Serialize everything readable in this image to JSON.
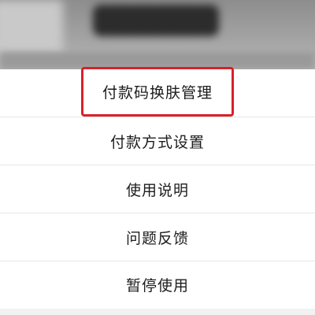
{
  "menu": {
    "items": [
      {
        "label": "付款码换肤管理",
        "highlighted": true
      },
      {
        "label": "付款方式设置"
      },
      {
        "label": "使用说明"
      },
      {
        "label": "问题反馈"
      },
      {
        "label": "暂停使用"
      }
    ]
  },
  "colors": {
    "highlight": "#d9202a",
    "text": "#1c1c1c",
    "divider": "#e6e6e6"
  }
}
